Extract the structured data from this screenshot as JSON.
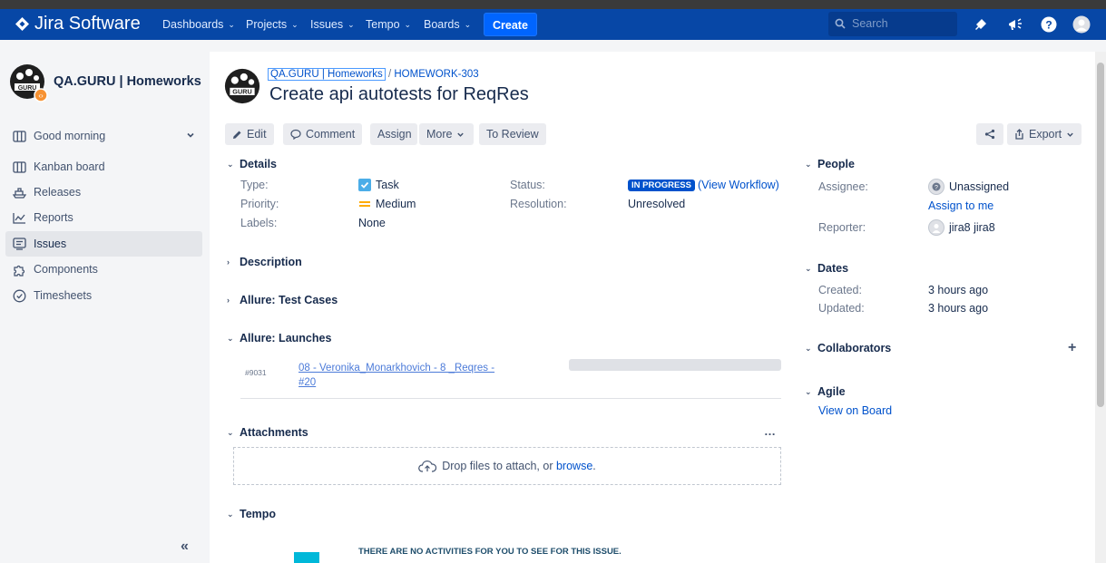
{
  "nav": {
    "app_name": "Jira Software",
    "menus": [
      {
        "label": "Dashboards"
      },
      {
        "label": "Projects"
      },
      {
        "label": "Issues"
      },
      {
        "label": "Tempo"
      },
      {
        "label": "Boards"
      }
    ],
    "create_label": "Create",
    "search_placeholder": "Search"
  },
  "sidebar": {
    "project_name": "QA.GURU | Homeworks",
    "items": [
      {
        "label": "Good morning",
        "icon": "board-icon"
      },
      {
        "label": "Kanban board",
        "icon": "board-icon"
      },
      {
        "label": "Releases",
        "icon": "ship-icon"
      },
      {
        "label": "Reports",
        "icon": "chart-icon"
      },
      {
        "label": "Issues",
        "icon": "issues-icon"
      },
      {
        "label": "Components",
        "icon": "puzzle-icon"
      },
      {
        "label": "Timesheets",
        "icon": "clock-icon"
      }
    ],
    "collapse_label": "«"
  },
  "issue": {
    "breadcrumb_project": "QA.GURU | Homeworks",
    "breadcrumb_sep": "/",
    "key": "HOMEWORK-303",
    "title": "Create api autotests for ReqRes"
  },
  "toolbar": {
    "edit": "Edit",
    "comment": "Comment",
    "assign": "Assign",
    "more": "More",
    "to_review": "To Review",
    "export": "Export"
  },
  "details": {
    "heading": "Details",
    "type_label": "Type:",
    "type_value": "Task",
    "priority_label": "Priority:",
    "priority_value": "Medium",
    "labels_label": "Labels:",
    "labels_value": "None",
    "status_label": "Status:",
    "status_value": "IN PROGRESS",
    "workflow_link": "(View Workflow)",
    "resolution_label": "Resolution:",
    "resolution_value": "Unresolved"
  },
  "sections": {
    "description": "Description",
    "allure_test_cases": "Allure: Test Cases",
    "allure_launches": "Allure: Launches",
    "attachments": "Attachments",
    "tempo": "Tempo"
  },
  "launch": {
    "id": "#9031",
    "name_line1": "08 - Veronika_Monarkhovich - 8 _Reqres -",
    "name_line2": "#20"
  },
  "attachments": {
    "drop_text": "Drop files to attach, or",
    "browse": "browse",
    "period": ".",
    "menu": "…"
  },
  "tempo": {
    "notice": "THERE ARE NO ACTIVITIES FOR YOU TO SEE FOR THIS ISSUE."
  },
  "people": {
    "heading": "People",
    "assignee_label": "Assignee:",
    "assignee_value": "Unassigned",
    "assign_to_me": "Assign to me",
    "reporter_label": "Reporter:",
    "reporter_value": "jira8 jira8"
  },
  "dates": {
    "heading": "Dates",
    "created_label": "Created:",
    "created_value": "3 hours ago",
    "updated_label": "Updated:",
    "updated_value": "3 hours ago"
  },
  "collaborators": {
    "heading": "Collaborators",
    "add": "+"
  },
  "agile": {
    "heading": "Agile",
    "view_on_board": "View on Board"
  },
  "colors": {
    "nav": "#0747a6",
    "create": "#0065ff",
    "link": "#0052cc",
    "status": "#0052cc"
  }
}
